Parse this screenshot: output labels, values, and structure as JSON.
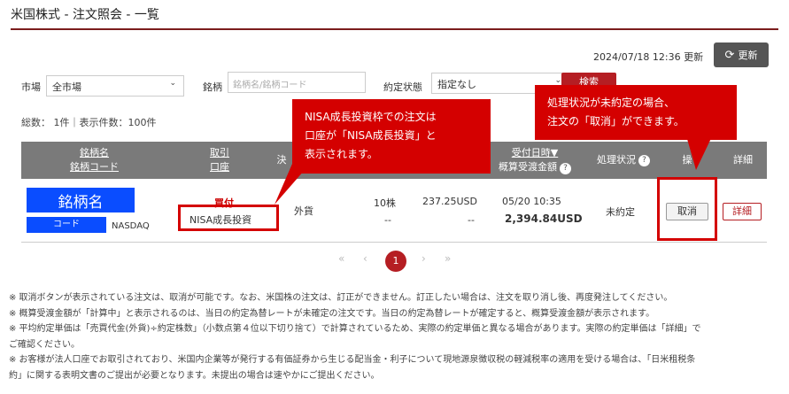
{
  "header": {
    "title": "米国株式 - 注文照会 - 一覧",
    "updated": "2024/07/18 12:36 更新",
    "refresh_label": "更新"
  },
  "filters": {
    "market_label": "市場",
    "market_value": "全市場",
    "symbol_label": "銘柄",
    "symbol_placeholder": "銘柄名/銘柄コード",
    "status_label": "約定状態",
    "status_value": "指定なし",
    "search_label": "検索"
  },
  "summary": {
    "count": "総数： 1件｜表示件数：100件"
  },
  "table": {
    "headers": {
      "name": "銘柄名",
      "code": "銘柄コード",
      "trade": "取引",
      "account": "口座",
      "settle": "決",
      "received": "受付日時▼",
      "estimate": "概算受渡金額",
      "status": "処理状況",
      "op": "操",
      "detail": "詳細"
    },
    "row": {
      "name": "銘柄名",
      "code": "コード",
      "market": "NASDAQ",
      "side": "買付",
      "account": "NISA成長投資",
      "settle": "外貨",
      "qty": "10株",
      "qty_exec": "--",
      "price": "237.25USD",
      "price_exec": "--",
      "date": "05/20 10:35",
      "amount": "2,394.84USD",
      "status": "未約定",
      "cancel": "取消",
      "detail": "詳細"
    }
  },
  "callouts": {
    "left": [
      "NISA成長投資枠での注文は",
      "口座が「NISA成長投資」と",
      "表示されます。"
    ],
    "right": [
      "処理状況が未約定の場合、",
      "注文の「取消」ができます。"
    ]
  },
  "pagination": {
    "first": "«",
    "prev": "‹",
    "current": "1",
    "next": "›",
    "last": "»"
  },
  "notes": [
    "※ 取消ボタンが表示されている注文は、取消が可能です。なお、米国株の注文は、訂正ができません。訂正したい場合は、注文を取り消し後、再度発注してください。",
    "※ 概算受渡金額が「計算中」と表示されるのは、当日の約定為替レートが未確定の注文です。当日の約定為替レートが確定すると、概算受渡金額が表示されます。",
    "※ 平均約定単価は「売買代金(外貨)÷約定株数」（小数点第４位以下切り捨て）で計算されているため、実際の約定単価と異なる場合があります。実際の約定単価は「詳細」で",
    "ご確認ください。",
    "※ お客様が法人口座でお取引されており、米国内企業等が発行する有価証券から生じる配当金・利子について現地源泉徴収税の軽減税率の適用を受ける場合は、「日米租税条",
    "約」に関する表明文書のご提出が必要となります。未提出の場合は速やかにご提出ください。"
  ]
}
